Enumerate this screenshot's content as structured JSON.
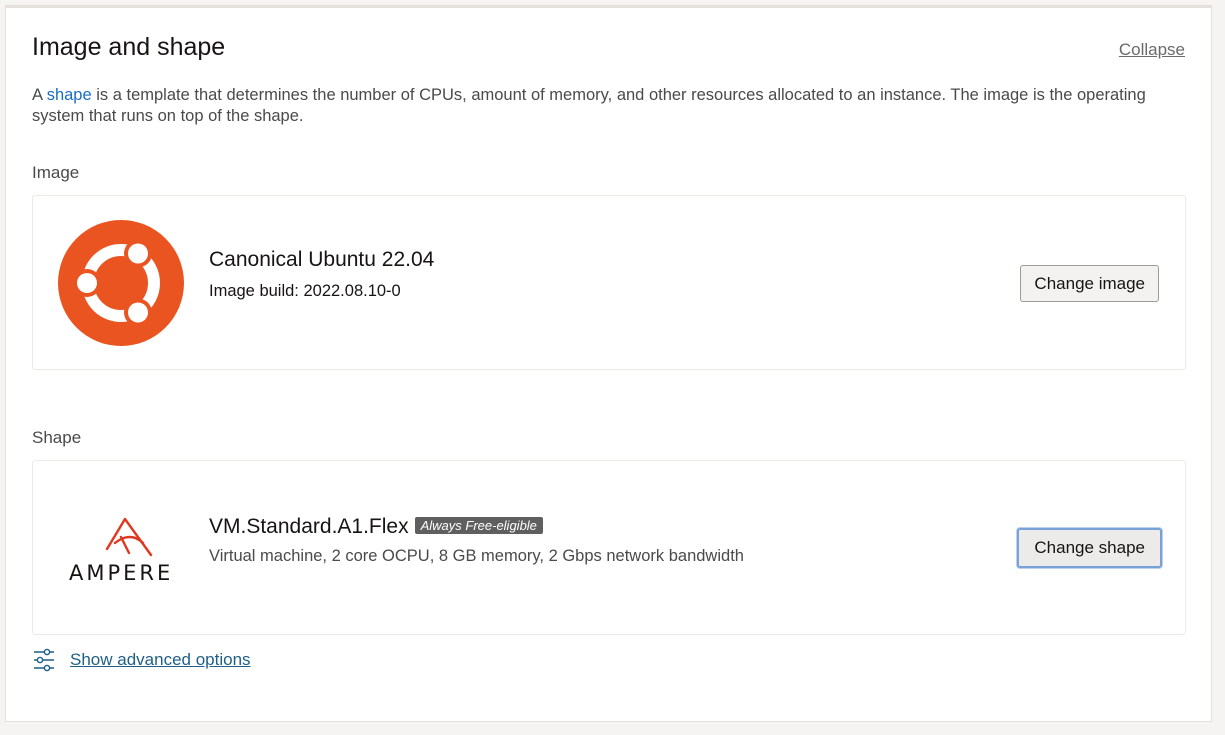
{
  "header": {
    "title": "Image and shape",
    "collapse_label": "Collapse"
  },
  "description": {
    "prefix": "A ",
    "link": "shape",
    "text": " is a template that determines the number of CPUs, amount of memory, and other resources allocated to an instance. The image is the operating system that runs on top of the shape."
  },
  "image": {
    "section_label": "Image",
    "name": "Canonical Ubuntu 22.04",
    "build": "Image build: 2022.08.10-0",
    "logo_icon": "ubuntu-logo-icon",
    "logo_color": "#e95420",
    "button_label": "Change image"
  },
  "shape": {
    "section_label": "Shape",
    "name": "VM.Standard.A1.Flex",
    "badge": "Always Free-eligible",
    "details": "Virtual machine, 2 core OCPU, 8 GB memory, 2 Gbps network bandwidth",
    "logo_text": "AMPERE",
    "logo_icon": "ampere-logo-icon",
    "logo_color": "#e0371f",
    "button_label": "Change shape"
  },
  "advanced": {
    "icon": "sliders-icon",
    "label": "Show advanced options"
  }
}
